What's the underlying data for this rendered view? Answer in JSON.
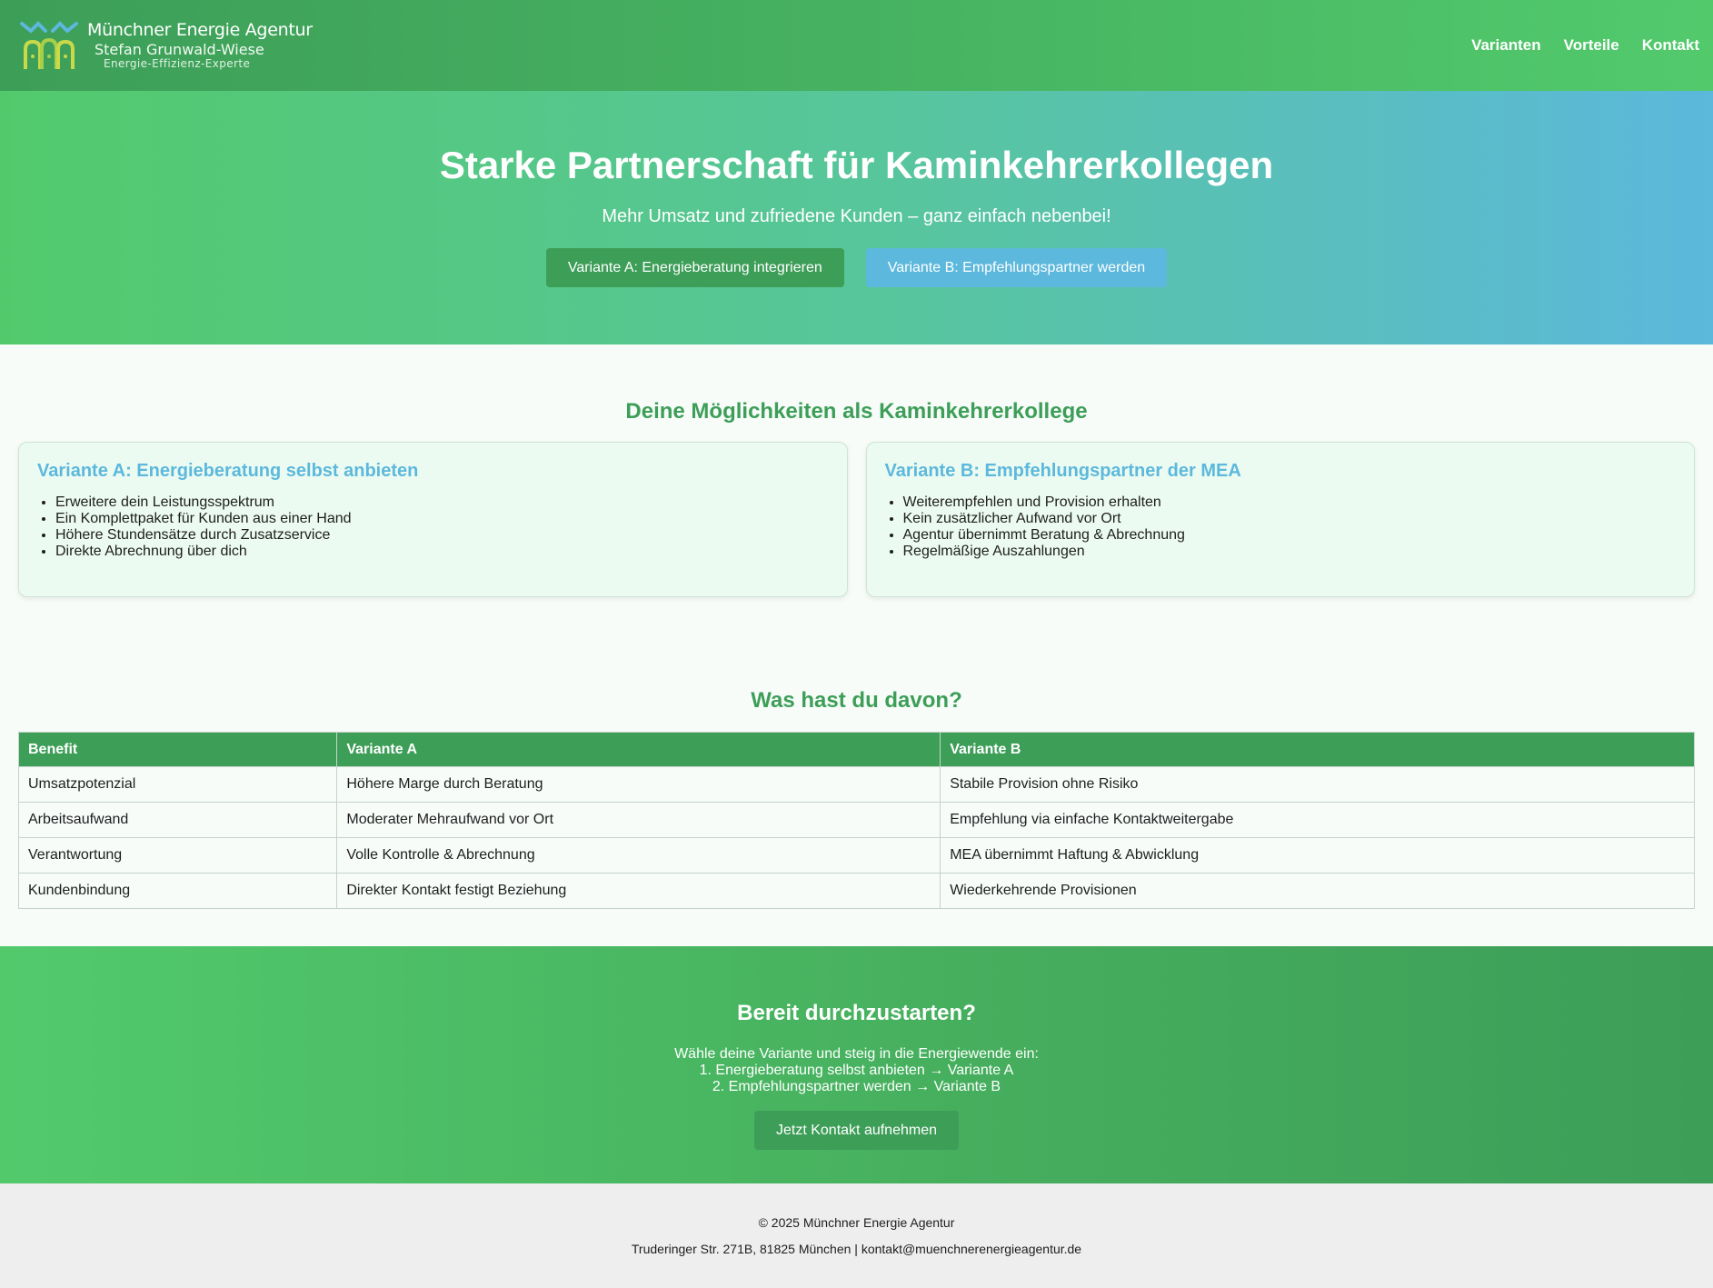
{
  "header": {
    "logo": {
      "brand": "Münchner Energie Agentur",
      "name": "Stefan Grunwald-Wiese",
      "tagline": "Energie-Effizienz-Experte"
    },
    "nav": [
      "Varianten",
      "Vorteile",
      "Kontakt"
    ]
  },
  "hero": {
    "title": "Starke Partnerschaft für Kaminkehrerkollegen",
    "subtitle": "Mehr Umsatz und zufriedene Kunden – ganz einfach nebenbei!",
    "button_a": "Variante A: Energieberatung integrieren",
    "button_b": "Variante B: Empfehlungspartner werden"
  },
  "variants": {
    "title": "Deine Möglichkeiten als Kaminkehrerkollege",
    "cards": [
      {
        "title": "Variante A: Energieberatung selbst anbieten",
        "items": [
          "Erweitere dein Leistungsspektrum",
          "Ein Komplettpaket für Kunden aus einer Hand",
          "Höhere Stundensätze durch Zusatzservice",
          "Direkte Abrechnung über dich"
        ]
      },
      {
        "title": "Variante B: Empfehlungspartner der MEA",
        "items": [
          "Weiterempfehlen und Provision erhalten",
          "Kein zusätzlicher Aufwand vor Ort",
          "Agentur übernimmt Beratung & Abrechnung",
          "Regelmäßige Auszahlungen"
        ]
      }
    ]
  },
  "benefits": {
    "title": "Was hast du davon?",
    "headers": [
      "Benefit",
      "Variante A",
      "Variante B"
    ],
    "rows": [
      [
        "Umsatzpotenzial",
        "Höhere Marge durch Beratung",
        "Stabile Provision ohne Risiko"
      ],
      [
        "Arbeitsaufwand",
        "Moderater Mehraufwand vor Ort",
        "Empfehlung via einfache Kontaktweitergabe"
      ],
      [
        "Verantwortung",
        "Volle Kontrolle & Abrechnung",
        "MEA übernimmt Haftung & Abwicklung"
      ],
      [
        "Kundenbindung",
        "Direkter Kontakt festigt Beziehung",
        "Wiederkehrende Provisionen"
      ]
    ]
  },
  "cta": {
    "title": "Bereit durchzustarten?",
    "lines": [
      "Wähle deine Variante und steig in die Energiewende ein:",
      "1. Energieberatung selbst anbieten → Variante A",
      "2. Empfehlungspartner werden → Variante B"
    ],
    "button": "Jetzt Kontakt aufnehmen"
  },
  "footer": {
    "copyright": "© 2025 Münchner Energie Agentur",
    "address": "Truderinger Str. 271B, 81825 München | kontakt@muenchnerenergieagentur.de"
  },
  "colors": {
    "primary_green": "#3d9e58",
    "light_green": "#52ca6c",
    "accent_blue": "#5cb8dc",
    "card_bg": "#ecfbf1"
  },
  "icons": {
    "logo": "mea-logo-icon"
  }
}
